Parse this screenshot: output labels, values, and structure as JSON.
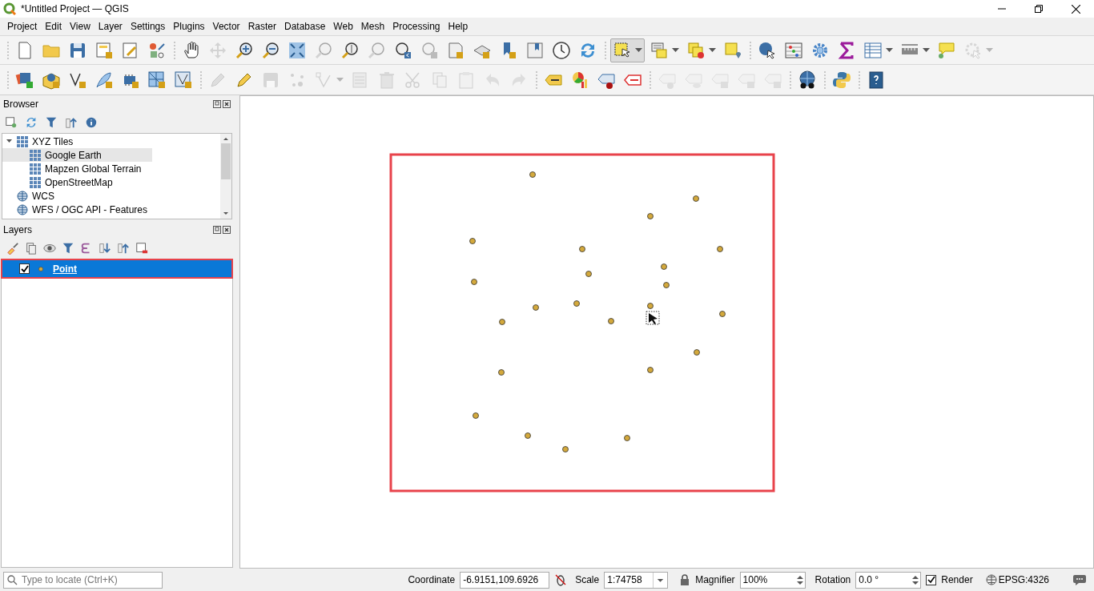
{
  "window": {
    "title": "*Untitled Project — QGIS"
  },
  "menu": [
    "Project",
    "Edit",
    "View",
    "Layer",
    "Settings",
    "Plugins",
    "Vector",
    "Raster",
    "Database",
    "Web",
    "Mesh",
    "Processing",
    "Help"
  ],
  "toolbars": [
    {
      "groups": [
        [
          {
            "disabled": false
          },
          {
            "disabled": false
          },
          {
            "disabled": false
          },
          {
            "disabled": false
          },
          {
            "disabled": false
          },
          {
            "disabled": false
          }
        ],
        [
          {
            "disabled": false
          },
          {
            "disabled": true
          },
          {
            "disabled": false
          },
          {
            "disabled": false
          },
          {
            "disabled": false
          },
          {
            "disabled": true
          },
          {
            "disabled": false
          },
          {
            "disabled": true
          },
          {
            "disabled": false
          },
          {
            "disabled": true
          },
          {
            "disabled": false
          },
          {
            "disabled": false
          },
          {
            "disabled": false
          },
          {
            "disabled": false
          },
          {
            "disabled": false
          },
          {
            "disabled": false
          }
        ],
        [
          {
            "disabled": false,
            "active": true,
            "menu": true
          },
          {
            "disabled": false,
            "menu": true
          },
          {
            "disabled": false,
            "menu": true
          },
          {
            "disabled": false
          }
        ],
        [
          {
            "disabled": false
          },
          {
            "disabled": false
          },
          {
            "disabled": false
          },
          {
            "disabled": false
          },
          {
            "disabled": false,
            "menu": true
          },
          {
            "disabled": false,
            "menu": true
          },
          {
            "disabled": false
          },
          {
            "disabled": true,
            "menu": true
          }
        ]
      ]
    },
    {
      "groups": [
        [
          {
            "disabled": false
          },
          {
            "disabled": false
          },
          {
            "disabled": false
          },
          {
            "disabled": false
          },
          {
            "disabled": false
          },
          {
            "disabled": false
          },
          {
            "disabled": false
          }
        ],
        [
          {
            "disabled": true
          },
          {
            "disabled": false
          },
          {
            "disabled": true
          },
          {
            "disabled": true
          },
          {
            "disabled": true,
            "menu": true
          },
          {
            "disabled": true
          },
          {
            "disabled": true
          },
          {
            "disabled": true
          },
          {
            "disabled": true
          },
          {
            "disabled": true
          },
          {
            "disabled": true
          },
          {
            "disabled": true
          }
        ],
        [
          {
            "disabled": false
          },
          {
            "disabled": false
          },
          {
            "disabled": false
          },
          {
            "disabled": false
          }
        ],
        [
          {
            "disabled": true
          },
          {
            "disabled": true
          },
          {
            "disabled": true
          },
          {
            "disabled": true
          },
          {
            "disabled": true
          }
        ],
        [
          {
            "disabled": false
          }
        ],
        [
          {
            "disabled": false
          }
        ],
        [
          {
            "disabled": false
          }
        ]
      ]
    }
  ],
  "browser": {
    "title": "Browser",
    "items": [
      {
        "label": "XYZ Tiles",
        "expanded": true,
        "selected": false,
        "children": [
          {
            "label": "Google Earth",
            "selected": true
          },
          {
            "label": "Mapzen Global Terrain",
            "selected": false
          },
          {
            "label": "OpenStreetMap",
            "selected": false
          }
        ]
      },
      {
        "label": "WCS",
        "selected": false
      },
      {
        "label": "WFS / OGC API - Features",
        "selected": false
      }
    ]
  },
  "layers": {
    "title": "Layers",
    "items": [
      {
        "label": "Point",
        "checked": true,
        "selected": true
      }
    ]
  },
  "status_bar": {
    "locate_placeholder": "Type to locate (Ctrl+K)",
    "coordinate_label": "Coordinate",
    "coordinate": "-6.9151,109.6926",
    "scale_label": "Scale",
    "scale": "1:74758",
    "magnifier_label": "Magnifier",
    "magnifier": "100%",
    "rotation_label": "Rotation",
    "rotation": "0.0 °",
    "render_label": "Render",
    "render": true,
    "crs": "EPSG:4326"
  }
}
